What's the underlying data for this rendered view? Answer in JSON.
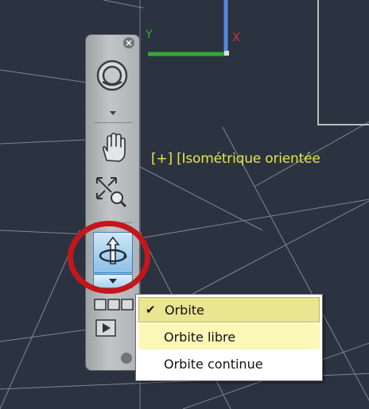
{
  "viewport": {
    "label": "[+] [Isométrique orientée"
  },
  "colors": {
    "background": "#2b3340",
    "viewport_label": "#e6e64a",
    "ucs_x_axis": "#cc3344",
    "ucs_y_axis": "#33aa33",
    "ucs_z_axis": "#5588dd",
    "highlight_ring": "#c4161c",
    "menu_checked_bg": "#e9e590",
    "menu_hover_bg": "#fbf8b8"
  },
  "ucs_icon": {
    "x_label": "X",
    "y_label": "Y"
  },
  "navbar": {
    "close_icon": "close-icon",
    "tools": [
      {
        "name": "steering-wheel",
        "icon": "steering-wheel-icon",
        "has_dropdown": true
      },
      {
        "name": "pan",
        "icon": "hand-icon"
      },
      {
        "name": "zoom-extents",
        "icon": "zoom-extents-icon"
      },
      {
        "name": "orbit",
        "icon": "orbit-icon",
        "has_dropdown": true,
        "active": true
      },
      {
        "name": "show-motion",
        "icon": "filmstrip-icon"
      },
      {
        "name": "show-motion-play",
        "icon": "play-icon"
      }
    ],
    "customize_icon": "customize-icon"
  },
  "orbit_menu": {
    "items": [
      {
        "label": "Orbite",
        "checked": true
      },
      {
        "label": "Orbite libre",
        "checked": false,
        "hovered": true
      },
      {
        "label": "Orbite continue",
        "checked": false
      }
    ]
  }
}
